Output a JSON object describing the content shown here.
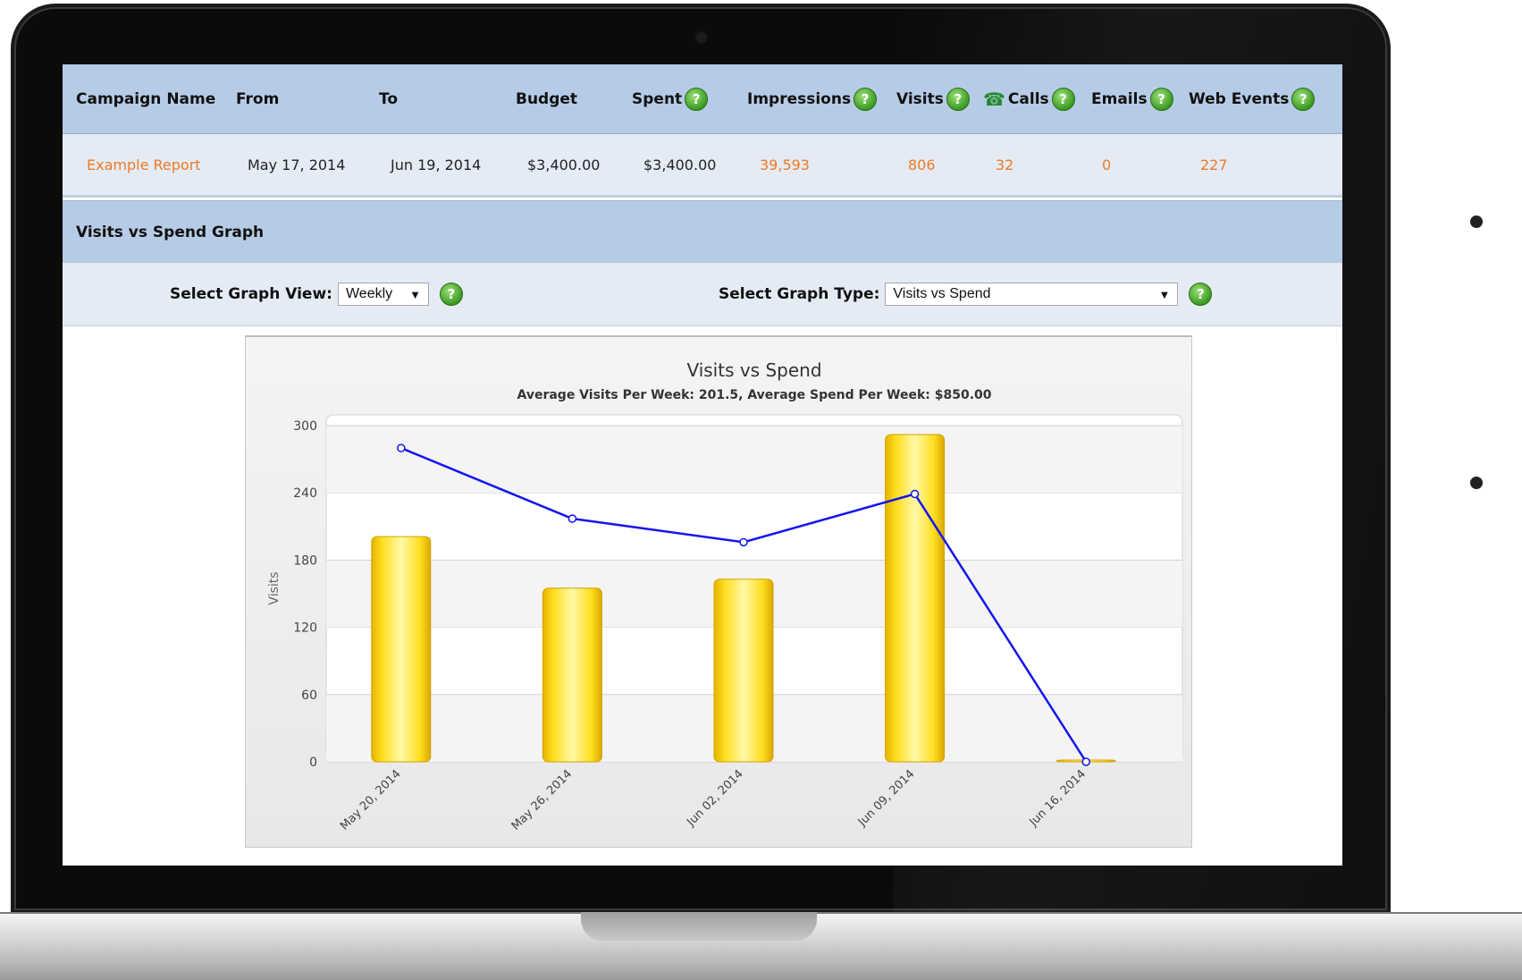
{
  "table": {
    "headers": {
      "campaign_name": "Campaign Name",
      "from": "From",
      "to": "To",
      "budget": "Budget",
      "spent": "Spent",
      "impressions": "Impressions",
      "visits": "Visits",
      "calls": "Calls",
      "emails": "Emails",
      "web_events": "Web Events"
    },
    "row": {
      "campaign_name": "Example Report",
      "from": "May 17, 2014",
      "to": "Jun 19, 2014",
      "budget": "$3,400.00",
      "spent": "$3,400.00",
      "impressions": "39,593",
      "visits": "806",
      "calls": "32",
      "emails": "0",
      "web_events": "227"
    },
    "help_glyph": "?",
    "phone_glyph": "☎"
  },
  "graph_section": {
    "title": "Visits vs Spend Graph",
    "view_label": "Select Graph View:",
    "view_value": "Weekly",
    "type_label": "Select Graph Type:",
    "type_value": "Visits vs Spend"
  },
  "colors": {
    "header_bg": "#b6cbe6",
    "row_bg": "#e4ebf5",
    "link_orange": "#f07a23",
    "bar_yellow": "#ffe633",
    "line_blue": "#1515ee",
    "help_green": "#3b9a22"
  },
  "chart_data": {
    "type": "bar",
    "title": "Visits vs Spend",
    "subtitle": "Average Visits Per Week: 201.5, Average Spend Per Week: $850.00",
    "ylabel": "Visits",
    "xlabel": "",
    "ylim": [
      0,
      300
    ],
    "yticks": [
      0,
      60,
      120,
      180,
      240,
      300
    ],
    "grid": true,
    "categories": [
      "May 20, 2014",
      "May 26, 2014",
      "Jun 02, 2014",
      "Jun 09, 2014",
      "Jun 16, 2014"
    ],
    "series": [
      {
        "type": "bar",
        "values": [
          201,
          155,
          163,
          292,
          1
        ]
      },
      {
        "type": "line",
        "values": [
          280,
          217,
          196,
          239,
          0
        ]
      }
    ]
  }
}
